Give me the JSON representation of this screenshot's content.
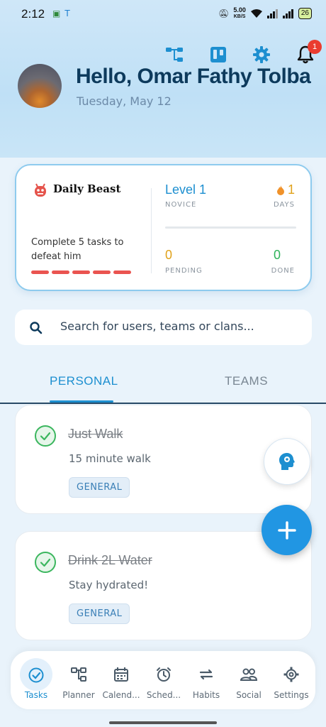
{
  "status_bar": {
    "time": "2:12",
    "speed_value": "5.00",
    "speed_unit": "KB/S",
    "battery": "26"
  },
  "header": {
    "greeting": "Hello, Omar Fathy Tolba",
    "date": "Tuesday, May 12",
    "notification_count": "1"
  },
  "beast_card": {
    "title": "Daily Beast",
    "description": "Complete 5 tasks to defeat him",
    "level": "Level 1",
    "rank": "NOVICE",
    "days_value": "1",
    "days_label": "DAYS",
    "pending_value": "0",
    "pending_label": "PENDING",
    "done_value": "0",
    "done_label": "DONE",
    "health_segments": 5
  },
  "search": {
    "placeholder": "Search for users, teams or clans..."
  },
  "tabs": {
    "personal": "PERSONAL",
    "teams": "TEAMS",
    "active": "personal"
  },
  "tasks": [
    {
      "title": "Just Walk",
      "subtitle": "15 minute walk",
      "tag": "GENERAL",
      "completed": true
    },
    {
      "title": "Drink 2L Water",
      "subtitle": "Stay hydrated!",
      "tag": "GENERAL",
      "completed": true
    }
  ],
  "bottom_nav": [
    {
      "label": "Tasks",
      "icon": "tasks-check-icon",
      "active": true
    },
    {
      "label": "Planner",
      "icon": "planner-icon",
      "active": false
    },
    {
      "label": "Calend...",
      "icon": "calendar-icon",
      "active": false
    },
    {
      "label": "Sched...",
      "icon": "alarm-clock-icon",
      "active": false
    },
    {
      "label": "Habits",
      "icon": "repeat-icon",
      "active": false
    },
    {
      "label": "Social",
      "icon": "people-icon",
      "active": false
    },
    {
      "label": "Settings",
      "icon": "settings-gear-icon",
      "active": false
    }
  ],
  "colors": {
    "accent": "#1d8fd0",
    "fab": "#2196e3",
    "badge": "#ea3c2f",
    "health": "#ea5450",
    "days": "#e0a21b",
    "done": "#2fb35a"
  }
}
